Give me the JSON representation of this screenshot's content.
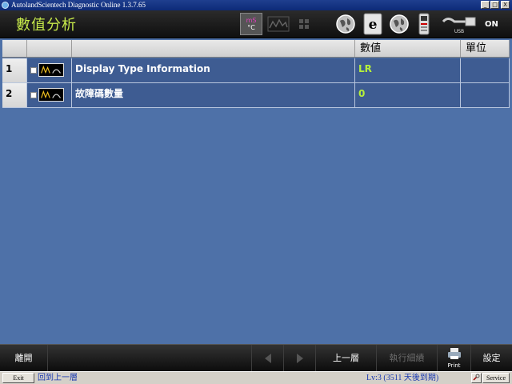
{
  "window": {
    "title": "AutolandScientech Diagnostic Online 1.3.7.65",
    "min": "_",
    "max": "□",
    "close": "X"
  },
  "toolbar": {
    "page_title": "數值分析",
    "unit_top": "mS",
    "unit_bottom": "°C",
    "usb_label": "USB",
    "on_label": "ON"
  },
  "table": {
    "headers": [
      "",
      "",
      "",
      "數値",
      "單位"
    ],
    "rows": [
      {
        "num": "1",
        "name": "Display Type Information",
        "value": "LR",
        "unit": ""
      },
      {
        "num": "2",
        "name": "故障碼數量",
        "value": "0",
        "unit": ""
      }
    ]
  },
  "bottombar": {
    "exit": "離開",
    "back": "上一層",
    "run_detail": "執行細績",
    "print": "Print",
    "settings": "設定"
  },
  "statusbar": {
    "exit_btn": "Exit",
    "hint": "回到上一層",
    "license": "Lv:3 (3511 天後到期)",
    "service": "Service"
  },
  "colors": {
    "background": "#4e71a8",
    "row": "#3e5c92",
    "title_green": "#c6e94a",
    "value_green": "#b6f03a"
  }
}
